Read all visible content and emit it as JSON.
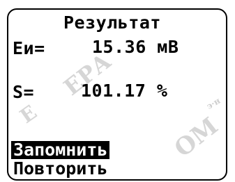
{
  "screen": {
    "title": "Результат",
    "measurements": [
      {
        "label": "Eи=",
        "value": "15.36 мВ"
      },
      {
        "label": "S=",
        "value": "101.17 %"
      }
    ],
    "menu": [
      {
        "label": "Запомнить",
        "selected": true
      },
      {
        "label": "Повторить",
        "selected": false
      }
    ],
    "watermark": "ENERGOMERA"
  }
}
